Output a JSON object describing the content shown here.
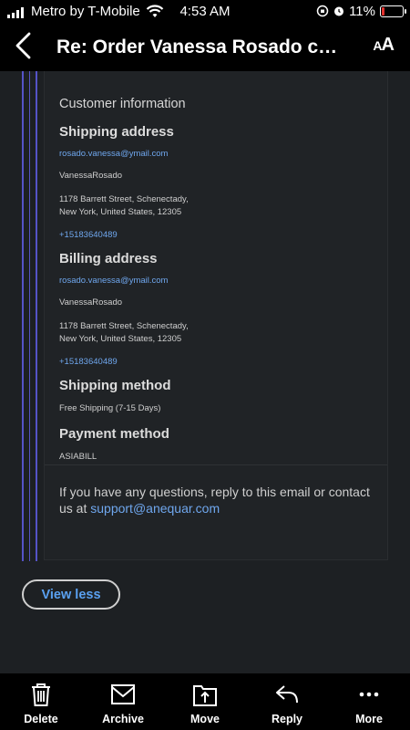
{
  "status_bar": {
    "carrier": "Metro by T-Mobile",
    "time": "4:53 AM",
    "battery_percent": "11%"
  },
  "header": {
    "title": "Re: Order Vanessa Rosado con...",
    "font_size_button": "AA"
  },
  "email": {
    "section_title": "Customer information",
    "shipping": {
      "heading": "Shipping address",
      "email": "rosado.vanessa@ymail.com",
      "name": "VanessaRosado",
      "address_line1": "1178 Barrett Street, Schenectady,",
      "address_line2": "New York, United States, 12305",
      "phone": "+15183640489"
    },
    "billing": {
      "heading": "Billing address",
      "email": "rosado.vanessa@ymail.com",
      "name": "VanessaRosado",
      "address_line1": "1178 Barrett Street, Schenectady,",
      "address_line2": "New York, United States, 12305",
      "phone": "+15183640489"
    },
    "shipping_method": {
      "heading": "Shipping method",
      "value": "Free Shipping (7-15 Days)"
    },
    "payment_method": {
      "heading": "Payment method",
      "value": "ASIABILL"
    },
    "footer_text": "If you have any questions, reply to this email or contact us at",
    "support_email": "support@anequar.com"
  },
  "view_less_label": "View less",
  "toolbar": {
    "delete": "Delete",
    "archive": "Archive",
    "move": "Move",
    "reply": "Reply",
    "more": "More"
  },
  "colors": {
    "link": "#6fa7ee",
    "quote_bar": "#5553c7",
    "background": "#1d2023",
    "battery_low": "#e4312d"
  }
}
